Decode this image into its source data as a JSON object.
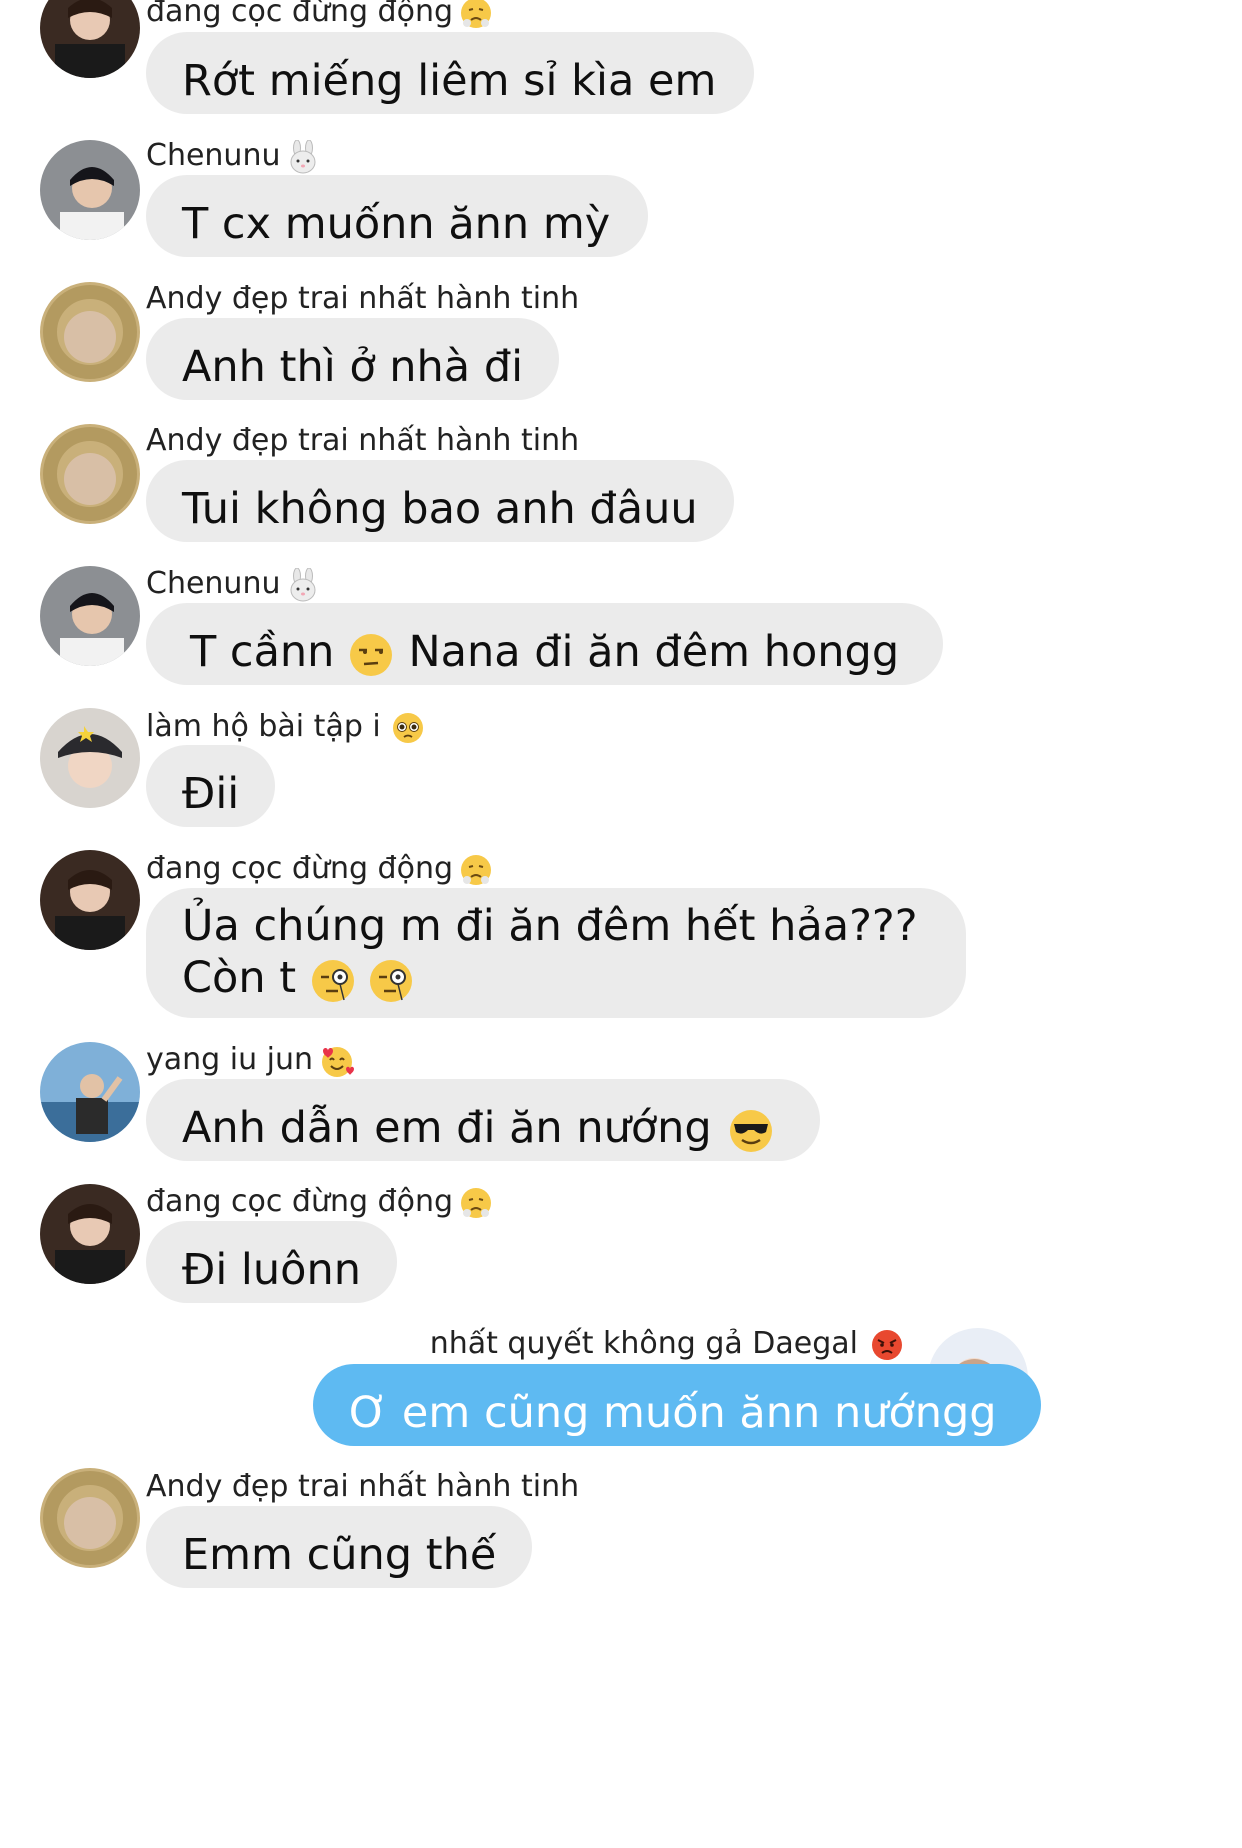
{
  "messages": [
    {
      "sender": "đang cọc đừng động",
      "sender_emoji": "steam-from-nose-icon",
      "text": "Rớt miếng liêm sỉ kìa em"
    },
    {
      "sender": "Chenunu",
      "sender_emoji": "rabbit-face-icon",
      "text": "T cx muốnn ănn mỳ"
    },
    {
      "sender": "Andy đẹp trai nhất hành tinh",
      "sender_emoji": "",
      "text": "Anh thì ở nhà đi"
    },
    {
      "sender": "Andy đẹp trai nhất hành tinh",
      "sender_emoji": "",
      "text": "Tui không bao anh đâuu"
    },
    {
      "sender": "Chenunu",
      "sender_emoji": "rabbit-face-icon",
      "text_a": "T cầnn",
      "inline_emoji": "unamused-face-icon",
      "text_b": "Nana đi ăn đêm hongg"
    },
    {
      "sender": "làm hộ bài tập i",
      "sender_emoji": "pleading-face-icon",
      "text": "Đii"
    },
    {
      "sender": "đang cọc đừng động",
      "sender_emoji": "steam-from-nose-icon",
      "line1": "Ủa chúng m đi ăn đêm hết hảa???",
      "line2": "Còn t",
      "line2_emojis": [
        "monocle-face-icon",
        "monocle-face-icon"
      ]
    },
    {
      "sender": "yang iu jun",
      "sender_emoji": "smiling-face-with-hearts-icon",
      "text": "Anh dẫn em đi ăn nướng",
      "inline_emoji": "sunglasses-face-icon"
    },
    {
      "sender": "đang cọc đừng động",
      "sender_emoji": "steam-from-nose-icon",
      "text": "Đi luônn"
    },
    {
      "sender": "nhất quyết không gả Daegal",
      "sender_emoji": "angry-face-icon",
      "text": "Ơ em cũng muốn ănn nướngg",
      "is_mine": true
    },
    {
      "sender": "Andy đẹp trai nhất hành tinh",
      "sender_emoji": "",
      "text": "Emm cũng thế"
    }
  ],
  "colors": {
    "incoming_bubble": "#ebebeb",
    "outgoing_bubble": "#5ebaf2",
    "outgoing_text": "#ffffff",
    "text": "#0f0f0f"
  }
}
